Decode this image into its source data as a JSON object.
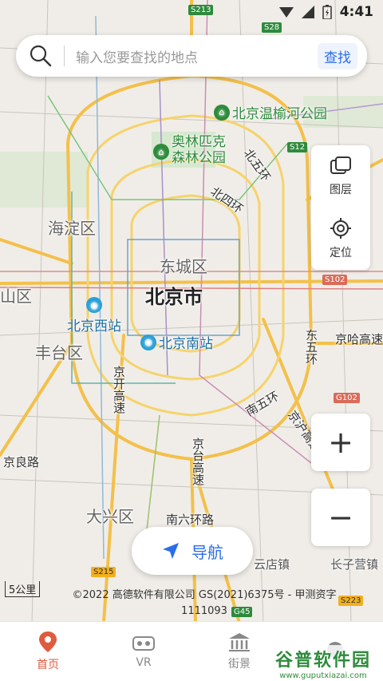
{
  "status_bar": {
    "time": "4:41"
  },
  "search": {
    "placeholder": "输入您要查找的地点",
    "button": "查找"
  },
  "right_panel": {
    "layers": "图层",
    "locate": "定位"
  },
  "zoom": {
    "in": "+",
    "out": "−"
  },
  "nav_button": {
    "label": "导航"
  },
  "scale": "5公里",
  "copyright": "©2022 高德软件有限公司 GS(2021)6375号 - 甲测资字1111093",
  "tabs": [
    {
      "label": "首页",
      "icon": "location-pin-icon",
      "active": true
    },
    {
      "label": "VR",
      "icon": "vr-headset-icon",
      "active": false
    },
    {
      "label": "街景",
      "icon": "street-view-icon",
      "active": false
    },
    {
      "label": "",
      "icon": "more-icon",
      "active": false
    }
  ],
  "watermark": {
    "line1": "谷普软件园",
    "line2": "www.guputxiazai.com"
  },
  "map": {
    "city": "北京市",
    "districts": [
      "海淀区",
      "东城区",
      "山区",
      "丰台区",
      "大兴区"
    ],
    "pois": [
      {
        "name": "北京温榆河公园",
        "type": "park"
      },
      {
        "name": "奥林匹克森林公园",
        "line1": "奥林匹克",
        "line2": "森林公园",
        "type": "park"
      },
      {
        "name": "北京西站",
        "type": "rail"
      },
      {
        "name": "北京南站",
        "type": "rail"
      }
    ],
    "roads": {
      "north_fifth_ring": "北五环",
      "north_fourth_ring": "北四环",
      "east_fifth_ring": "东五环",
      "south_fifth_ring": "南五环",
      "south_sixth_ring": "南六环路",
      "jingkai": "京开高速",
      "jingtai": "京台高速",
      "jingliang": "京良路",
      "jingha": "京哈高速",
      "jinghu": "京沪高速"
    },
    "towns": [
      "云店镇",
      "长子营镇"
    ],
    "shields": [
      "S213",
      "S28",
      "S12",
      "S102",
      "G102",
      "S215",
      "S223",
      "G45"
    ]
  },
  "colors": {
    "accent": "#2a6de8",
    "active_tab": "#e05a3e",
    "park": "#2e8b3c"
  }
}
